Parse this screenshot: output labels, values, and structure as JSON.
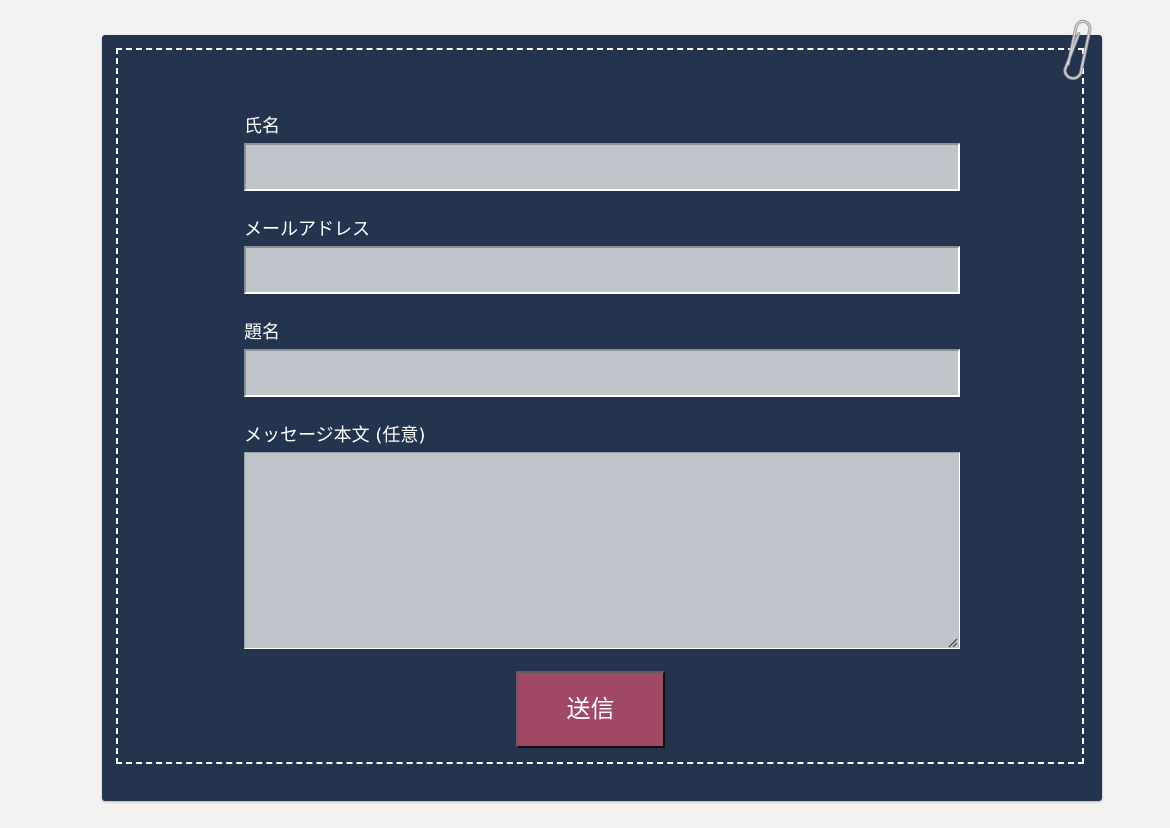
{
  "form": {
    "name_label": "氏名",
    "name_value": "",
    "email_label": "メールアドレス",
    "email_value": "",
    "subject_label": "題名",
    "subject_value": "",
    "message_label": "メッセージ本文 (任意)",
    "message_value": "",
    "submit_label": "送信"
  },
  "colors": {
    "page_background": "#f3f2f1",
    "card_background": "#25344e",
    "input_background": "#bfc3ca",
    "submit_button": "#a14865",
    "label_text": "#ffffff"
  },
  "icons": {
    "paperclip": "paperclip-icon",
    "resize": "resize-grip-icon"
  }
}
